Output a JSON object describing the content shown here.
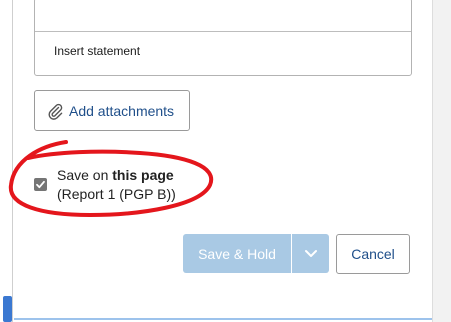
{
  "editor": {
    "insert_statement_label": "Insert statement"
  },
  "attachments": {
    "button_label": "Add attachments",
    "icon": "paperclip-icon"
  },
  "save_on": {
    "checked": true,
    "prefix": "Save on",
    "emphasis": "this page",
    "context": "(Report 1 (PGP B))"
  },
  "actions": {
    "save_hold_label": "Save & Hold",
    "save_hold_disabled": true,
    "dropdown_icon": "chevron-down-icon",
    "cancel_label": "Cancel"
  },
  "colors": {
    "link_blue": "#1f4f8a",
    "disabled_button": "#a9c9e4",
    "annotation_red": "#e4161c"
  }
}
